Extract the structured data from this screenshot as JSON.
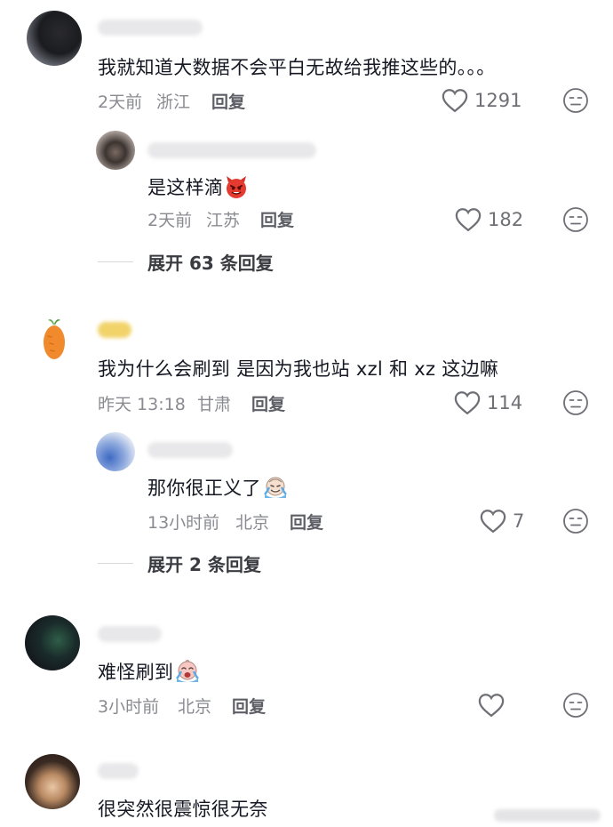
{
  "comments": [
    {
      "text": "我就知道大数据不会平白无故给我推这些的。。。",
      "time": "2天前",
      "location": "浙江",
      "reply_label": "回复",
      "likes": "1291",
      "replies": [
        {
          "text": "是这样滴",
          "emoji": "devil-emoji",
          "time": "2天前",
          "location": "江苏",
          "reply_label": "回复",
          "likes": "182"
        }
      ],
      "expand_label": "展开 63 条回复"
    },
    {
      "text": "我为什么会刷到 是因为我也站 xzl 和 xz 这边嘛",
      "time": "昨天 13:18",
      "location": "甘肃",
      "reply_label": "回复",
      "likes": "114",
      "replies": [
        {
          "text": "那你很正义了",
          "emoji": "crying-laughing-emoji",
          "time": "13小时前",
          "location": "北京",
          "reply_label": "回复",
          "likes": "7"
        }
      ],
      "expand_label": "展开 2 条回复"
    },
    {
      "text": "难怪刷到",
      "emoji": "crying-emoji",
      "time": "3小时前",
      "location": "北京",
      "reply_label": "回复",
      "likes": ""
    },
    {
      "text": "很突然很震惊很无奈"
    }
  ],
  "colors": {
    "text_primary": "#161823",
    "text_meta": "#8a8b91",
    "icon": "#6f7076"
  }
}
